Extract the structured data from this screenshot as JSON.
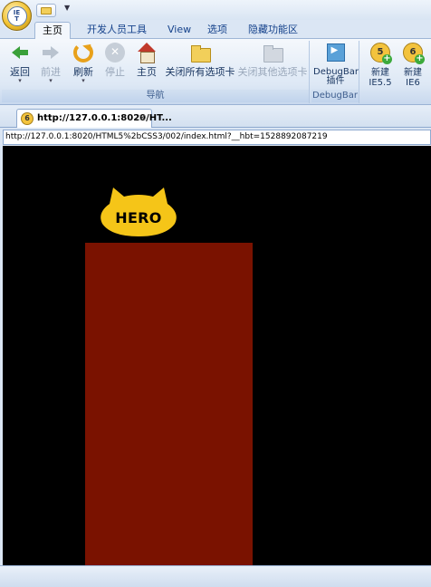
{
  "quick_access": {
    "orb_text": "IE\nTester",
    "menu_arrow": "▼"
  },
  "ribbon": {
    "tabs": [
      {
        "label": "主页",
        "active": true
      },
      {
        "label": "开发人员工具",
        "active": false
      },
      {
        "label": "View",
        "active": false
      },
      {
        "label": "选项",
        "active": false
      },
      {
        "label": "隐藏功能区",
        "active": false
      }
    ],
    "nav_group": {
      "label": "导航",
      "buttons": [
        {
          "label": "返回",
          "icon": "back-arrow-icon",
          "enabled": true,
          "dropdown": true
        },
        {
          "label": "前进",
          "icon": "forward-arrow-icon",
          "enabled": false,
          "dropdown": true
        },
        {
          "label": "刷新",
          "icon": "refresh-icon",
          "enabled": true,
          "dropdown": true
        },
        {
          "label": "停止",
          "icon": "stop-icon",
          "enabled": false
        },
        {
          "label": "主页",
          "icon": "home-icon",
          "enabled": true
        },
        {
          "label": "关闭所有选项卡",
          "icon": "folder-icon",
          "enabled": true
        },
        {
          "label": "关闭其他选项卡",
          "icon": "folder-icon",
          "enabled": false
        }
      ]
    },
    "debug_group": {
      "label": "DebugBar",
      "button": {
        "label_line1": "DebugBar",
        "label_line2": "插件",
        "icon": "debugbar-icon"
      }
    },
    "new_group": {
      "buttons": [
        {
          "label_line1": "新建",
          "label_line2": "IE5.5",
          "version": "5"
        },
        {
          "label_line1": "新建",
          "label_line2": "IE6",
          "version": "6"
        }
      ]
    }
  },
  "document_tab": {
    "version_badge": "6",
    "title": "http://127.0.0.1:8020/HT...",
    "close": "×"
  },
  "address_bar": {
    "url": "http://127.0.0.1:8020/HTML5%2bCSS3/002/index.html?__hbt=1528892087219"
  },
  "page": {
    "hero_text": "HERO",
    "colors": {
      "background": "#000000",
      "hero_badge": "#f5c518",
      "block": "#7a1200"
    }
  }
}
